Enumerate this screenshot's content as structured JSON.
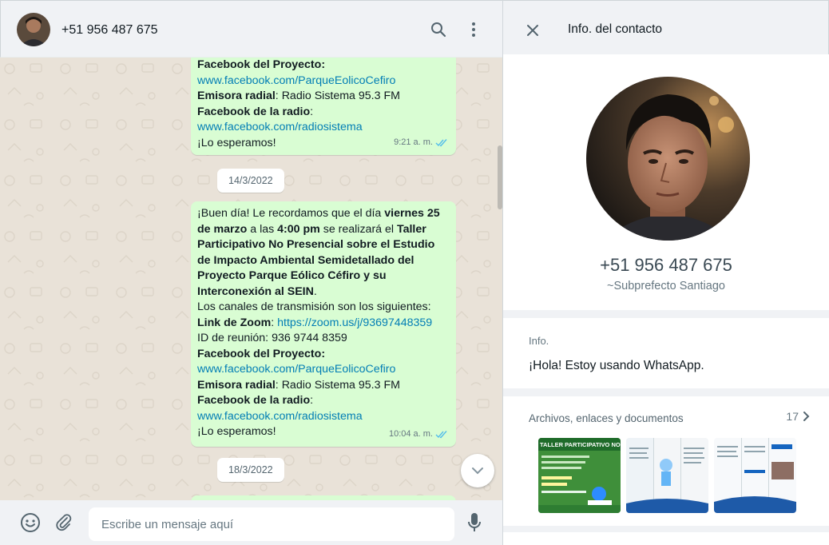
{
  "chat": {
    "contact_phone": "+51 956 487 675",
    "composer_placeholder": "Escribe un mensaje aquí",
    "messages": [
      {
        "lines": {
          "fb_project_label": "Facebook del Proyecto",
          "fb_project_url": "www.facebook.com/ParqueEolicoCefiro",
          "radio_label": "Emisora radial",
          "radio_value": "Radio Sistema 95.3 FM",
          "fb_radio_label": "Facebook de la radio",
          "fb_radio_url": "www.facebook.com/radiosistema",
          "closing": "¡Lo esperamos!"
        },
        "time": "9:21 a. m."
      },
      {
        "lines": {
          "greeting": "¡Buen día! Le recordamos que el día ",
          "date_bold": "viernes 25 de marzo",
          "at": " a las ",
          "time_bold": "4:00 pm",
          "will_be": " se realizará el ",
          "event_bold": "Taller Participativo No Presencial sobre el Estudio de Impacto Ambiental Semidetallado del Proyecto Parque Eólico Céfiro y su Interconexión al SEIN",
          "period": ".",
          "channels": "Los canales de transmisión son los siguientes:",
          "zoom_label": "Link de Zoom",
          "zoom_url": "https://zoom.us/j/93697448359",
          "meeting_id": "ID de reunión: 936 9744 8359",
          "fb_project_label": "Facebook del Proyecto",
          "fb_project_url": "www.facebook.com/ParqueEolicoCefiro",
          "radio_label": "Emisora radial",
          "radio_value": "Radio Sistema 95.3 FM",
          "fb_radio_label": "Facebook de la radio",
          "fb_radio_url": "www.facebook.com/radiosistema",
          "closing": "¡Lo esperamos!"
        },
        "time": "10:04 a. m."
      }
    ],
    "dates": [
      "14/3/2022",
      "18/3/2022"
    ]
  },
  "info": {
    "title": "Info. del contacto",
    "phone": "+51 956 487 675",
    "push_name": "~Subprefecto Santiago",
    "about_label": "Info.",
    "about_text": "¡Hola! Estoy usando WhatsApp.",
    "media_label": "Archivos, enlaces y documentos",
    "media_count": "17",
    "thumbnails": [
      {
        "caption": "TALLER PARTICIPATIVO NO PRESENCI"
      },
      {
        "caption": ""
      },
      {
        "caption": ""
      }
    ]
  },
  "colors": {
    "outgoing_bubble": "#d9fdd3",
    "link": "#027eb5",
    "read_ticks": "#53bdeb",
    "panel_bg": "#f0f2f5",
    "chat_bg": "#e9e2d8"
  },
  "icons": [
    "search-icon",
    "menu-icon",
    "close-icon",
    "emoji-icon",
    "attach-icon",
    "mic-icon",
    "chevron-down-icon",
    "chevron-right-icon",
    "double-check-icon"
  ]
}
